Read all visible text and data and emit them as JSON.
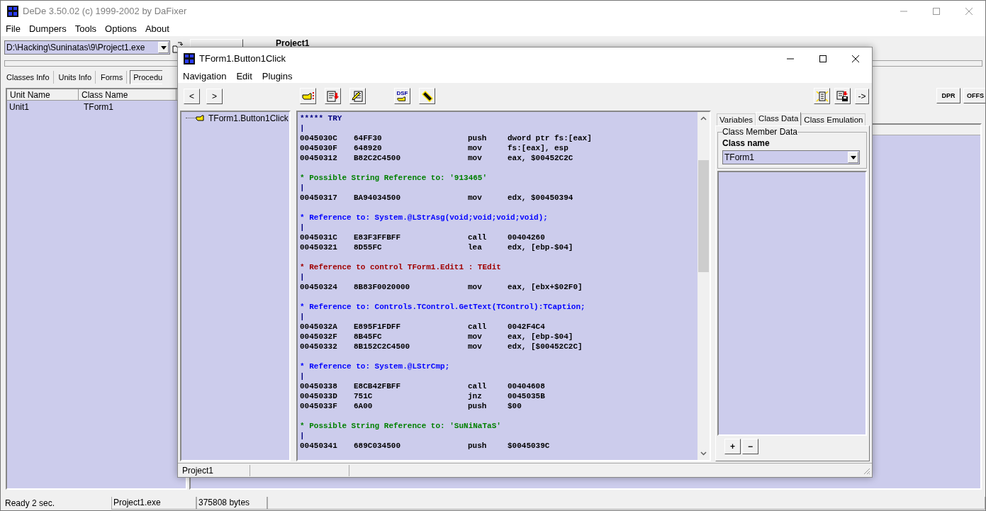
{
  "main": {
    "title": "DeDe 3.50.02 (c) 1999-2002 by DaFixer",
    "menu": [
      "File",
      "Dumpers",
      "Tools",
      "Options",
      "About"
    ],
    "path": "D:\\Hacking\\Suninatas\\9\\Project1.exe",
    "progress": {
      "level": 0
    },
    "project_label": "Project1",
    "tabs": [
      {
        "label": "Classes Info",
        "selected": false
      },
      {
        "label": "Units Info",
        "selected": false
      },
      {
        "label": "Forms",
        "selected": false
      },
      {
        "label": "Procedu",
        "selected": true
      }
    ],
    "list": {
      "columns": [
        "Unit Name",
        "Class Name"
      ],
      "rows": [
        [
          "Unit1",
          "TForm1"
        ]
      ]
    },
    "buttons": [
      "DPR",
      "OFFS"
    ],
    "status_bar": [
      "Ready 2 sec.",
      "Project1.exe",
      "375808 bytes"
    ]
  },
  "child": {
    "title": "TForm1.Button1Click",
    "menu": [
      "Navigation",
      "Edit",
      "Plugins"
    ],
    "nav_buttons": [
      "<",
      ">"
    ],
    "tools": [
      {
        "kind": "hand"
      },
      {
        "kind": "doc-arrow"
      },
      {
        "kind": "doc-edit"
      },
      {
        "kind": "dsf",
        "label": "DSF"
      },
      {
        "kind": "chip"
      }
    ],
    "right_tools": [
      {
        "kind": "doc-star"
      },
      {
        "kind": "doc-save"
      },
      {
        "kind": "text",
        "label": "->"
      }
    ],
    "tree": [
      {
        "label": "TForm1.Button1Click"
      }
    ],
    "code": [
      {
        "kind": "comment",
        "text": "***** TRY",
        "color": "#000080"
      },
      {
        "kind": "bar",
        "text": "|"
      },
      {
        "kind": "asm",
        "address": "0045030C",
        "bytes": "64FF30",
        "mnemonic": "push",
        "operand": "dword ptr fs:[eax]"
      },
      {
        "kind": "asm",
        "address": "0045030F",
        "bytes": "648920",
        "mnemonic": "mov",
        "operand": "fs:[eax], esp"
      },
      {
        "kind": "asm",
        "address": "00450312",
        "bytes": "B82C2C4500",
        "mnemonic": "mov",
        "operand": "eax, $00452C2C"
      },
      {
        "kind": "blank"
      },
      {
        "kind": "comment",
        "text": "* Possible String Reference to: '913465'",
        "color": "#008000"
      },
      {
        "kind": "bar",
        "text": "|"
      },
      {
        "kind": "asm",
        "address": "00450317",
        "bytes": "BA94034500",
        "mnemonic": "mov",
        "operand": "edx, $00450394"
      },
      {
        "kind": "blank"
      },
      {
        "kind": "comment",
        "text": "* Reference to: System.@LStrAsg(void;void;void;void);",
        "color": "#0000ff"
      },
      {
        "kind": "bar",
        "text": "|"
      },
      {
        "kind": "asm",
        "address": "0045031C",
        "bytes": "E83F3FFBFF",
        "mnemonic": "call",
        "operand": "00404260"
      },
      {
        "kind": "asm",
        "address": "00450321",
        "bytes": "8D55FC",
        "mnemonic": "lea",
        "operand": "edx, [ebp-$04]"
      },
      {
        "kind": "blank"
      },
      {
        "kind": "comment",
        "text": "* Reference to control TForm1.Edit1 : TEdit",
        "color": "#a00000"
      },
      {
        "kind": "bar",
        "text": "|"
      },
      {
        "kind": "asm",
        "address": "00450324",
        "bytes": "8B83F0020000",
        "mnemonic": "mov",
        "operand": "eax, [ebx+$02F0]"
      },
      {
        "kind": "blank"
      },
      {
        "kind": "comment",
        "text": "* Reference to: Controls.TControl.GetText(TControl):TCaption;",
        "color": "#0000ff"
      },
      {
        "kind": "bar",
        "text": "|"
      },
      {
        "kind": "asm",
        "address": "0045032A",
        "bytes": "E895F1FDFF",
        "mnemonic": "call",
        "operand": "0042F4C4"
      },
      {
        "kind": "asm",
        "address": "0045032F",
        "bytes": "8B45FC",
        "mnemonic": "mov",
        "operand": "eax, [ebp-$04]"
      },
      {
        "kind": "asm",
        "address": "00450332",
        "bytes": "8B152C2C4500",
        "mnemonic": "mov",
        "operand": "edx, [$00452C2C]"
      },
      {
        "kind": "blank"
      },
      {
        "kind": "comment",
        "text": "* Reference to: System.@LStrCmp;",
        "color": "#0000ff"
      },
      {
        "kind": "bar",
        "text": "|"
      },
      {
        "kind": "asm",
        "address": "00450338",
        "bytes": "E8CB42FBFF",
        "mnemonic": "call",
        "operand": "00404608"
      },
      {
        "kind": "asm",
        "address": "0045033D",
        "bytes": "751C",
        "mnemonic": "jnz",
        "operand": "0045035B"
      },
      {
        "kind": "asm",
        "address": "0045033F",
        "bytes": "6A00",
        "mnemonic": "push",
        "operand": "$00"
      },
      {
        "kind": "blank"
      },
      {
        "kind": "comment",
        "text": "* Possible String Reference to: 'SuNiNaTaS'",
        "color": "#008000"
      },
      {
        "kind": "bar",
        "text": "|"
      },
      {
        "kind": "asm",
        "address": "00450341",
        "bytes": "689C034500",
        "mnemonic": "push",
        "operand": "$0045039C"
      }
    ],
    "side_tabs": [
      {
        "label": "Variables",
        "selected": false
      },
      {
        "label": "Class Data",
        "selected": true
      },
      {
        "label": "Class Emulation",
        "selected": false
      }
    ],
    "group_title": "Class Member Data",
    "class_label": "Class name",
    "class_value": "TForm1",
    "list_buttons": [
      "+",
      "−"
    ],
    "status_bar": [
      "Project1"
    ]
  }
}
